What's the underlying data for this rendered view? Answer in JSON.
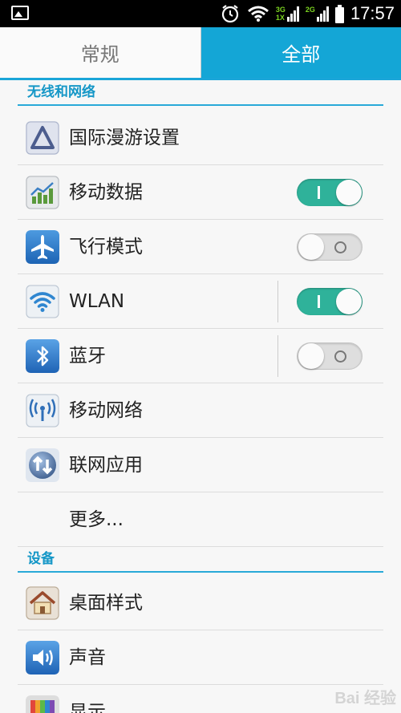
{
  "status_bar": {
    "time": "17:57",
    "net1_top": "3G",
    "net1_bottom": "1X",
    "net2": "2G"
  },
  "tabs": [
    {
      "label": "常规",
      "active": false
    },
    {
      "label": "全部",
      "active": true
    }
  ],
  "sections": {
    "wireless": {
      "title": "无线和网络",
      "items": [
        {
          "label": "国际漫游设置",
          "icon": "roaming-triangle-icon"
        },
        {
          "label": "移动数据",
          "icon": "mobile-data-chart-icon",
          "toggle": "on"
        },
        {
          "label": "飞行模式",
          "icon": "airplane-icon",
          "toggle": "off"
        },
        {
          "label": "WLAN",
          "icon": "wifi-icon",
          "toggle": "on"
        },
        {
          "label": "蓝牙",
          "icon": "bluetooth-icon",
          "toggle": "off"
        },
        {
          "label": "移动网络",
          "icon": "mobile-network-icon"
        },
        {
          "label": "联网应用",
          "icon": "network-apps-icon"
        },
        {
          "label": "更多..."
        }
      ]
    },
    "device": {
      "title": "设备",
      "items": [
        {
          "label": "桌面样式",
          "icon": "home-style-icon"
        },
        {
          "label": "声音",
          "icon": "sound-icon"
        },
        {
          "label": "显示",
          "icon": "display-icon"
        }
      ]
    }
  },
  "watermark": "Bai 经验",
  "colors": {
    "accent": "#14a6d6",
    "toggle_on": "#2fb29a"
  }
}
